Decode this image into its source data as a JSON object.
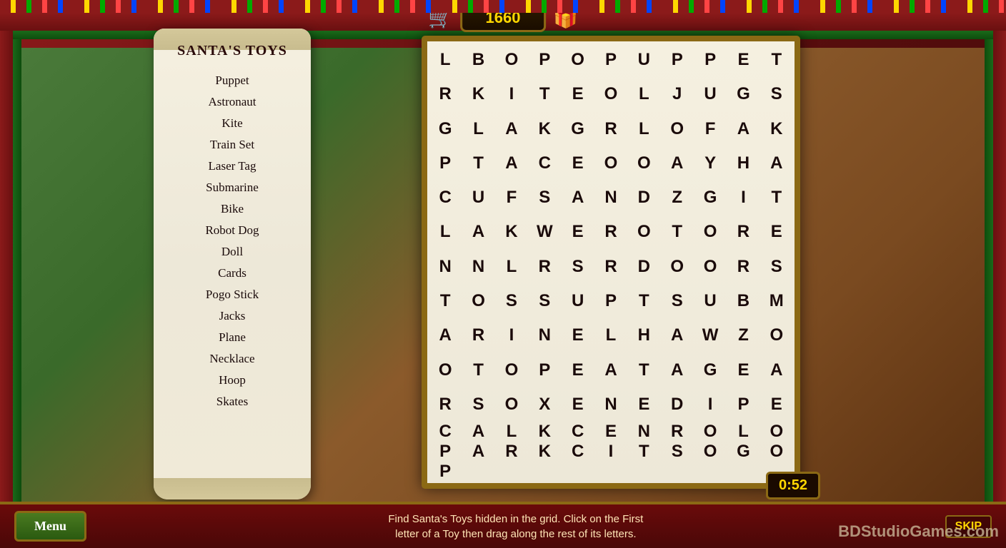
{
  "game": {
    "title": "SANTA'S TOYS",
    "score": "1660",
    "timer": "0:52",
    "instructions_line1": "Find Santa's Toys hidden in the grid. Click on the First",
    "instructions_line2": "letter of a Toy then drag along the rest of its letters.",
    "menu_label": "Menu",
    "skip_label": "SKIP",
    "watermark": "BDStudioGames.com"
  },
  "word_list": {
    "items": [
      {
        "word": "Puppet",
        "found": false
      },
      {
        "word": "Astronaut",
        "found": false
      },
      {
        "word": "Kite",
        "found": false
      },
      {
        "word": "Train Set",
        "found": false
      },
      {
        "word": "Laser Tag",
        "found": false
      },
      {
        "word": "Submarine",
        "found": false
      },
      {
        "word": "Bike",
        "found": false
      },
      {
        "word": "Robot Dog",
        "found": false
      },
      {
        "word": "Doll",
        "found": false
      },
      {
        "word": "Cards",
        "found": false
      },
      {
        "word": "Pogo Stick",
        "found": false
      },
      {
        "word": "Jacks",
        "found": false
      },
      {
        "word": "Plane",
        "found": false
      },
      {
        "word": "Necklace",
        "found": false
      },
      {
        "word": "Hoop",
        "found": false
      },
      {
        "word": "Skates",
        "found": false
      }
    ]
  },
  "grid": {
    "rows": [
      [
        "L",
        "B",
        "O",
        "P",
        "O",
        "P",
        "U",
        "P",
        "P",
        "E",
        "T",
        "R"
      ],
      [
        "K",
        "I",
        "T",
        "E",
        "O",
        "L",
        "J",
        "U",
        "G",
        "S",
        "G",
        "L"
      ],
      [
        "A",
        "K",
        "G",
        "R",
        "L",
        "O",
        "F",
        "A",
        "K",
        "P",
        "T",
        "A"
      ],
      [
        "C",
        "E",
        "O",
        "O",
        "A",
        "Y",
        "H",
        "A",
        "C",
        "U",
        "F",
        "S"
      ],
      [
        "A",
        "N",
        "D",
        "Z",
        "G",
        "I",
        "T",
        "L",
        "A",
        "K",
        "W",
        "E"
      ],
      [
        "R",
        "O",
        "T",
        "O",
        "R",
        "E",
        "N",
        "N",
        "L",
        "R",
        "S",
        "R"
      ],
      [
        "D",
        "O",
        "O",
        "R",
        "S",
        "T",
        "O",
        "S",
        "S",
        "U",
        "P",
        "T"
      ],
      [
        "S",
        "U",
        "B",
        "M",
        "A",
        "R",
        "I",
        "N",
        "E",
        "L",
        "H",
        "A"
      ],
      [
        "W",
        "Z",
        "O",
        "O",
        "T",
        "O",
        "P",
        "E",
        "A",
        "T",
        "A",
        "G"
      ],
      [
        "E",
        "A",
        "R",
        "S",
        "O",
        "X",
        "E",
        "N",
        "E",
        "D",
        "I",
        "P"
      ],
      [
        "E",
        "C",
        "A",
        "L",
        "K",
        "C",
        "E",
        "N",
        "R",
        "O",
        "L",
        "O"
      ],
      [
        "P",
        "A",
        "R",
        "K",
        "C",
        "I",
        "T",
        "S",
        "O",
        "G",
        "O",
        "P"
      ]
    ]
  },
  "icons": {
    "cart": "🛒",
    "gift": "🎁"
  }
}
